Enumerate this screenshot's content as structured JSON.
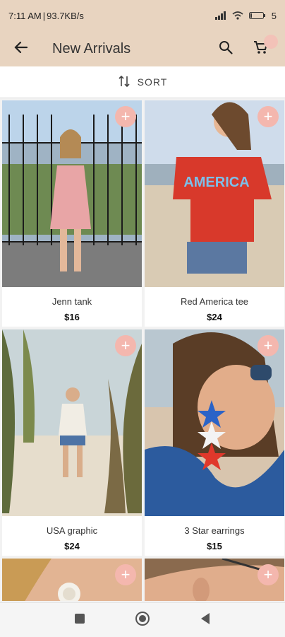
{
  "status": {
    "time": "7:11 AM",
    "separator": "|",
    "net_speed": "93.7KB/s",
    "battery": "5"
  },
  "header": {
    "title": "New Arrivals"
  },
  "sort": {
    "label": "SORT"
  },
  "products": [
    {
      "name": "Jenn tank",
      "price": "$16"
    },
    {
      "name": "Red America tee",
      "price": "$24",
      "shirt_text": "AMERICA"
    },
    {
      "name": "USA graphic",
      "price": "$24"
    },
    {
      "name": "3 Star earrings",
      "price": "$15"
    },
    {
      "name": "",
      "price": ""
    },
    {
      "name": "",
      "price": ""
    }
  ],
  "colors": {
    "header_bg": "#e8d4c0",
    "add_button": "#f4b7ae"
  },
  "icons": [
    "back-arrow-icon",
    "search-icon",
    "cart-icon",
    "sort-icon",
    "plus-icon",
    "square-icon",
    "circle-icon",
    "triangle-back-icon"
  ]
}
